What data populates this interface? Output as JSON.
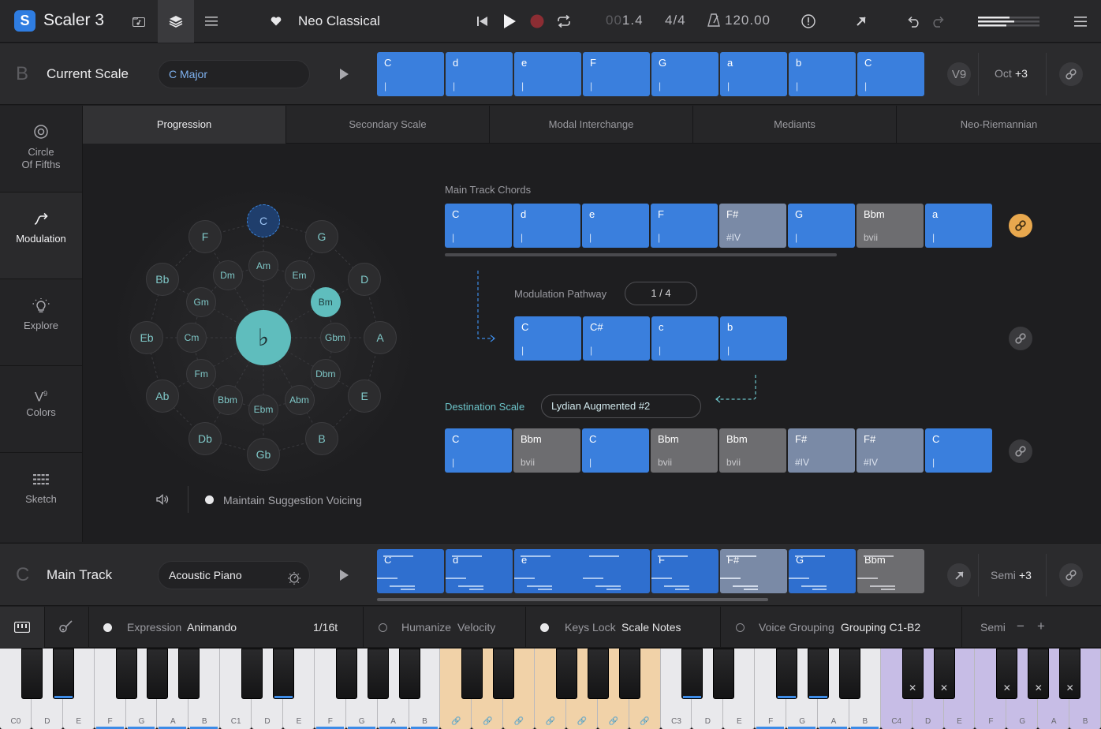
{
  "app": {
    "title": "Scaler 3",
    "logo": "S"
  },
  "topbar": {
    "song": "Neo Classical",
    "position": "1.4",
    "position_prefix": "00",
    "time_signature": "4/4",
    "tempo": "120.00"
  },
  "scale": {
    "letter": "B",
    "title": "Current Scale",
    "value": "C Major",
    "oct_label": "Oct",
    "oct_value": "+3",
    "voicing_label": "V9",
    "chords": [
      {
        "name": "C",
        "roman": "|"
      },
      {
        "name": "d",
        "roman": "|"
      },
      {
        "name": "e",
        "roman": "|"
      },
      {
        "name": "F",
        "roman": "|"
      },
      {
        "name": "G",
        "roman": "|"
      },
      {
        "name": "a",
        "roman": "|"
      },
      {
        "name": "b",
        "roman": "|"
      },
      {
        "name": "C",
        "roman": "|"
      }
    ]
  },
  "nav": [
    {
      "label1": "Circle",
      "label2": "Of Fifths",
      "icon": "circle-target-icon"
    },
    {
      "label1": "Modulation",
      "label2": "",
      "icon": "modulation-arrow-icon"
    },
    {
      "label1": "Explore",
      "label2": "",
      "icon": "lightbulb-icon"
    },
    {
      "label1": "Colors",
      "label2": "",
      "icon": "v9-icon"
    },
    {
      "label1": "Sketch",
      "label2": "",
      "icon": "sketch-grid-icon"
    }
  ],
  "tabs": [
    "Progression",
    "Secondary Scale",
    "Modal Interchange",
    "Mediants",
    "Neo-Riemannian"
  ],
  "circle": {
    "center": "♭",
    "outer": [
      "C",
      "G",
      "D",
      "A",
      "E",
      "B",
      "Gb",
      "Db",
      "Ab",
      "Eb",
      "Bb",
      "F"
    ],
    "inner": [
      "Am",
      "Em",
      "Bm",
      "Gbm",
      "Dbm",
      "Abm",
      "Ebm",
      "Bbm",
      "Fm",
      "Cm",
      "Gm",
      "Dm"
    ]
  },
  "maintain_voicing": "Maintain Suggestion Voicing",
  "main_track_chords": {
    "label": "Main Track Chords",
    "chords": [
      {
        "name": "C",
        "roman": "|",
        "style": "blue"
      },
      {
        "name": "d",
        "roman": "|",
        "style": "blue"
      },
      {
        "name": "e",
        "roman": "|",
        "style": "blue"
      },
      {
        "name": "F",
        "roman": "|",
        "style": "blue"
      },
      {
        "name": "F#",
        "roman": "#IV",
        "style": "slate"
      },
      {
        "name": "G",
        "roman": "|",
        "style": "blue"
      },
      {
        "name": "Bbm",
        "roman": "bvii",
        "style": "grey"
      },
      {
        "name": "a",
        "roman": "|",
        "style": "blue"
      }
    ]
  },
  "pathway": {
    "label": "Modulation Pathway",
    "counter": "1 / 4",
    "chords": [
      {
        "name": "C",
        "roman": "|"
      },
      {
        "name": "C#",
        "roman": "|"
      },
      {
        "name": "c",
        "roman": "|"
      },
      {
        "name": "b",
        "roman": "|"
      }
    ]
  },
  "destination": {
    "label": "Destination Scale",
    "value": "Lydian Augmented #2",
    "chords": [
      {
        "name": "C",
        "roman": "|",
        "style": "blue"
      },
      {
        "name": "Bbm",
        "roman": "bvii",
        "style": "grey"
      },
      {
        "name": "C",
        "roman": "|",
        "style": "blue"
      },
      {
        "name": "Bbm",
        "roman": "bvii",
        "style": "grey"
      },
      {
        "name": "Bbm",
        "roman": "bvii",
        "style": "grey"
      },
      {
        "name": "F#",
        "roman": "#IV",
        "style": "slate"
      },
      {
        "name": "F#",
        "roman": "#IV",
        "style": "slate"
      },
      {
        "name": "C",
        "roman": "|",
        "style": "blue"
      }
    ]
  },
  "track": {
    "letter": "C",
    "title": "Main Track",
    "instrument": "Acoustic Piano",
    "semi_label": "Semi",
    "semi_value": "+3",
    "chords": [
      {
        "name": "C",
        "style": "blue",
        "w": 1
      },
      {
        "name": "d",
        "style": "blue",
        "w": 1
      },
      {
        "name": "e",
        "style": "blue",
        "w": 2
      },
      {
        "name": "F",
        "style": "blue",
        "w": 1
      },
      {
        "name": "F#",
        "style": "slate",
        "w": 1
      },
      {
        "name": "G",
        "style": "blue",
        "w": 1
      },
      {
        "name": "Bbm",
        "style": "grey",
        "w": 1
      }
    ]
  },
  "options": {
    "expression_label": "Expression",
    "expression_value": "Animando",
    "rate": "1/16t",
    "humanize_label": "Humanize",
    "humanize_value": "Velocity",
    "keyslock_label": "Keys Lock",
    "keyslock_value": "Scale Notes",
    "voicegroup_label": "Voice Grouping",
    "voicegroup_value": "Grouping C1-B2",
    "semi_label": "Semi",
    "minus": "−",
    "plus": "+"
  },
  "keyboard": {
    "white": [
      "C0",
      "D",
      "E",
      "F",
      "G",
      "A",
      "B",
      "C1",
      "D",
      "E",
      "F",
      "G",
      "A",
      "B",
      "🔗",
      "🔗",
      "🔗",
      "🔗",
      "🔗",
      "🔗",
      "🔗",
      "C3",
      "D",
      "E",
      "F",
      "G",
      "A",
      "B",
      "C4",
      "D",
      "E",
      "F",
      "G",
      "A",
      "B"
    ],
    "black_mark": "✕",
    "link": "🔗"
  }
}
